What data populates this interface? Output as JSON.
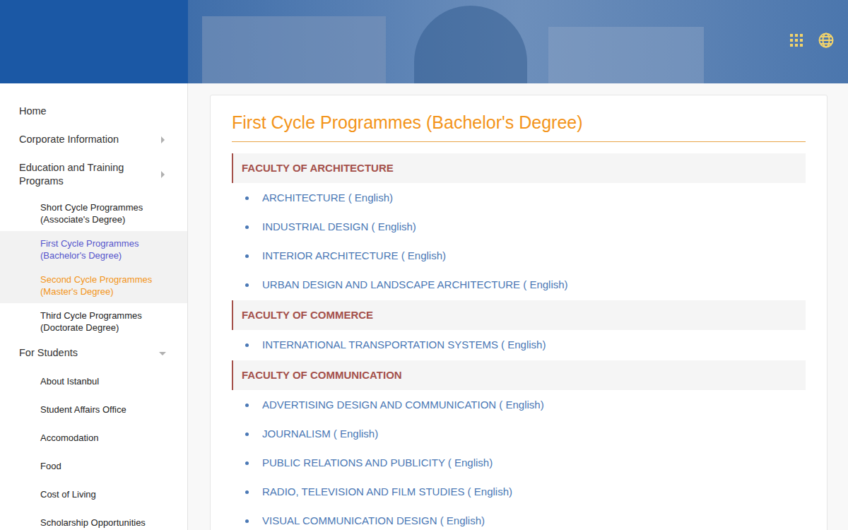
{
  "sidebar": {
    "items": [
      {
        "label": "Home",
        "kind": "top",
        "selected": false,
        "highlighted": false,
        "expandable": false,
        "expanded": false
      },
      {
        "label": "Corporate Information",
        "kind": "top",
        "selected": false,
        "highlighted": false,
        "expandable": true,
        "expanded": false
      },
      {
        "label": "Education and Training Programs",
        "kind": "top",
        "selected": false,
        "highlighted": false,
        "expandable": true,
        "expanded": false
      },
      {
        "label": "Short Cycle Programmes (Associate's Degree)",
        "kind": "sub",
        "selected": false,
        "highlighted": false,
        "expandable": false,
        "expanded": false
      },
      {
        "label": "First Cycle Programmes (Bachelor's Degree)",
        "kind": "sub",
        "selected": true,
        "highlighted": false,
        "expandable": false,
        "expanded": false
      },
      {
        "label": "Second Cycle Programmes (Master's Degree)",
        "kind": "sub",
        "selected": false,
        "highlighted": true,
        "expandable": false,
        "expanded": false
      },
      {
        "label": "Third Cycle Programmes (Doctorate Degree)",
        "kind": "sub",
        "selected": false,
        "highlighted": false,
        "expandable": false,
        "expanded": false
      },
      {
        "label": "For Students",
        "kind": "top",
        "selected": false,
        "highlighted": false,
        "expandable": true,
        "expanded": true
      },
      {
        "label": "About Istanbul",
        "kind": "sub",
        "selected": false,
        "highlighted": false,
        "expandable": false,
        "expanded": false
      },
      {
        "label": "Student Affairs Office",
        "kind": "sub",
        "selected": false,
        "highlighted": false,
        "expandable": false,
        "expanded": false
      },
      {
        "label": "Accomodation",
        "kind": "sub",
        "selected": false,
        "highlighted": false,
        "expandable": false,
        "expanded": false
      },
      {
        "label": "Food",
        "kind": "sub",
        "selected": false,
        "highlighted": false,
        "expandable": false,
        "expanded": false
      },
      {
        "label": "Cost of Living",
        "kind": "sub",
        "selected": false,
        "highlighted": false,
        "expandable": false,
        "expanded": false
      },
      {
        "label": "Scholarship Opportunities",
        "kind": "sub",
        "selected": false,
        "highlighted": false,
        "expandable": false,
        "expanded": false
      }
    ]
  },
  "page": {
    "title": "First Cycle Programmes (Bachelor's Degree)",
    "faculties": [
      {
        "name": "FACULTY OF ARCHITECTURE",
        "programmes": [
          "ARCHITECTURE ( English)",
          "INDUSTRIAL DESIGN ( English)",
          "INTERIOR ARCHITECTURE ( English)",
          "URBAN DESIGN AND LANDSCAPE ARCHITECTURE ( English)"
        ]
      },
      {
        "name": "FACULTY OF COMMERCE",
        "programmes": [
          "INTERNATIONAL TRANSPORTATION SYSTEMS ( English)"
        ]
      },
      {
        "name": "FACULTY OF COMMUNICATION",
        "programmes": [
          "ADVERTISING DESIGN AND COMMUNICATION ( English)",
          "JOURNALISM ( English)",
          "PUBLIC RELATIONS AND PUBLICITY ( English)",
          "RADIO, TELEVISION AND FILM STUDIES ( English)",
          "VISUAL COMMUNICATION DESIGN ( English)"
        ]
      }
    ]
  }
}
